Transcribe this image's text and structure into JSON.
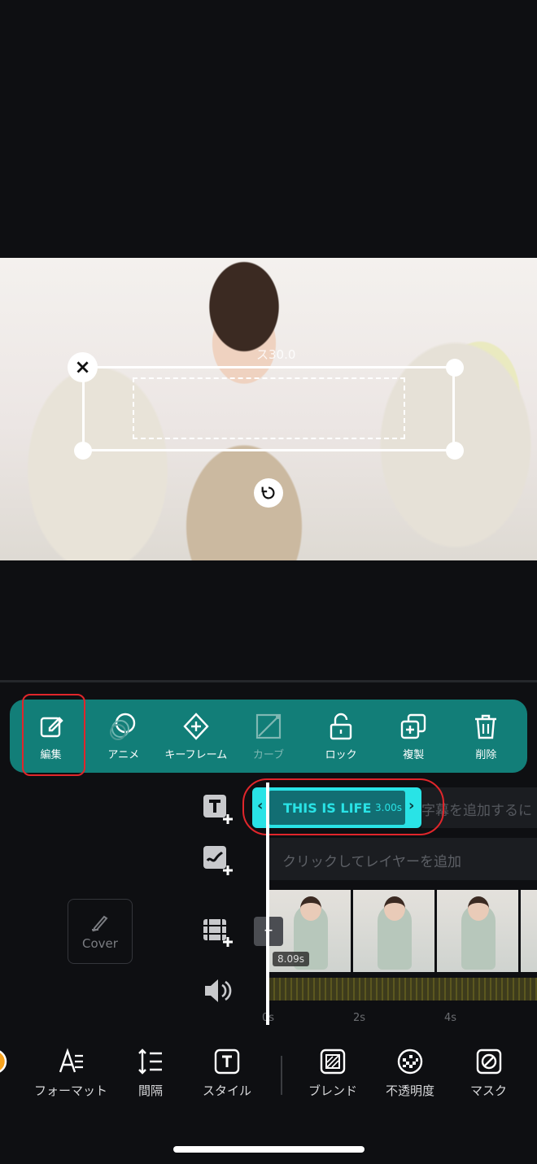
{
  "preview": {
    "overlay_text": "ス30.0"
  },
  "toolbar": {
    "items": [
      {
        "label": "編集",
        "icon": "edit-icon"
      },
      {
        "label": "アニメ",
        "icon": "animation-icon"
      },
      {
        "label": "キーフレーム",
        "icon": "keyframe-icon"
      },
      {
        "label": "カーブ",
        "icon": "curve-icon",
        "disabled": true
      },
      {
        "label": "ロック",
        "icon": "lock-icon"
      },
      {
        "label": "複製",
        "icon": "duplicate-icon"
      },
      {
        "label": "削除",
        "icon": "delete-icon"
      }
    ]
  },
  "timeline": {
    "text_clip": {
      "title": "THIS IS LIFE",
      "duration": "3.00s",
      "left_chevron": "‹",
      "right_chevron": "›"
    },
    "subtitle_hint": "字幕を追加するに",
    "layer_hint": "クリックしてレイヤーを追加",
    "video_duration": "8.09s",
    "minus_label": "–",
    "cover_label": "Cover",
    "ticks": [
      "0s",
      "2s",
      "4s"
    ]
  },
  "bottom_tools": [
    {
      "label": "ー",
      "icon": "color-icon"
    },
    {
      "label": "フォーマット",
      "icon": "format-icon"
    },
    {
      "label": "間隔",
      "icon": "spacing-icon"
    },
    {
      "label": "スタイル",
      "icon": "style-icon"
    },
    {
      "label": "ブレンド",
      "icon": "blend-icon"
    },
    {
      "label": "不透明度",
      "icon": "opacity-icon"
    },
    {
      "label": "マスク",
      "icon": "mask-icon"
    }
  ],
  "colors": {
    "accent": "#127e78",
    "clip": "#29e3e6",
    "highlight": "#e0262b"
  }
}
